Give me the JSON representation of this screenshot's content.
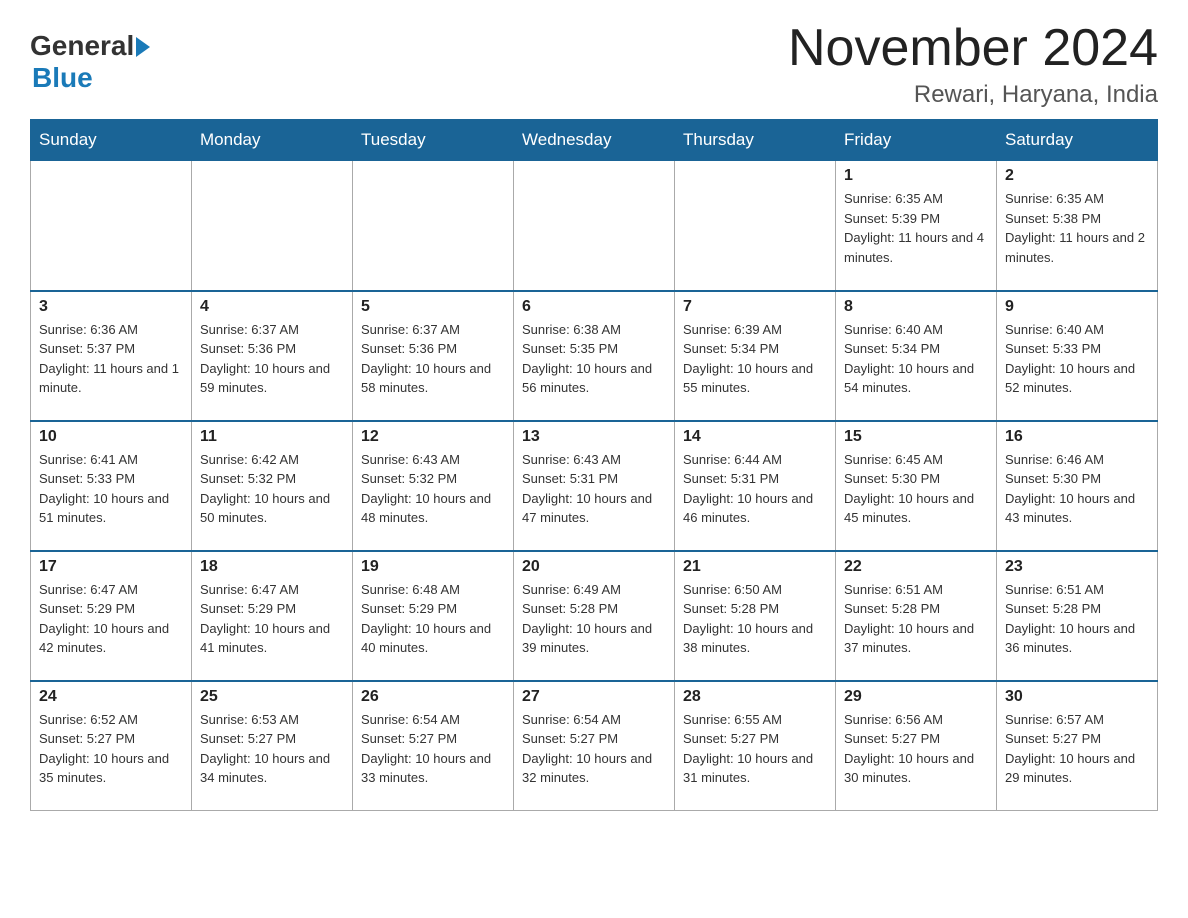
{
  "header": {
    "logo": {
      "general": "General",
      "arrow": "▶",
      "blue": "Blue"
    },
    "month_title": "November 2024",
    "location": "Rewari, Haryana, India"
  },
  "calendar": {
    "weekdays": [
      "Sunday",
      "Monday",
      "Tuesday",
      "Wednesday",
      "Thursday",
      "Friday",
      "Saturday"
    ],
    "weeks": [
      [
        {
          "day": "",
          "info": ""
        },
        {
          "day": "",
          "info": ""
        },
        {
          "day": "",
          "info": ""
        },
        {
          "day": "",
          "info": ""
        },
        {
          "day": "",
          "info": ""
        },
        {
          "day": "1",
          "info": "Sunrise: 6:35 AM\nSunset: 5:39 PM\nDaylight: 11 hours and 4 minutes."
        },
        {
          "day": "2",
          "info": "Sunrise: 6:35 AM\nSunset: 5:38 PM\nDaylight: 11 hours and 2 minutes."
        }
      ],
      [
        {
          "day": "3",
          "info": "Sunrise: 6:36 AM\nSunset: 5:37 PM\nDaylight: 11 hours and 1 minute."
        },
        {
          "day": "4",
          "info": "Sunrise: 6:37 AM\nSunset: 5:36 PM\nDaylight: 10 hours and 59 minutes."
        },
        {
          "day": "5",
          "info": "Sunrise: 6:37 AM\nSunset: 5:36 PM\nDaylight: 10 hours and 58 minutes."
        },
        {
          "day": "6",
          "info": "Sunrise: 6:38 AM\nSunset: 5:35 PM\nDaylight: 10 hours and 56 minutes."
        },
        {
          "day": "7",
          "info": "Sunrise: 6:39 AM\nSunset: 5:34 PM\nDaylight: 10 hours and 55 minutes."
        },
        {
          "day": "8",
          "info": "Sunrise: 6:40 AM\nSunset: 5:34 PM\nDaylight: 10 hours and 54 minutes."
        },
        {
          "day": "9",
          "info": "Sunrise: 6:40 AM\nSunset: 5:33 PM\nDaylight: 10 hours and 52 minutes."
        }
      ],
      [
        {
          "day": "10",
          "info": "Sunrise: 6:41 AM\nSunset: 5:33 PM\nDaylight: 10 hours and 51 minutes."
        },
        {
          "day": "11",
          "info": "Sunrise: 6:42 AM\nSunset: 5:32 PM\nDaylight: 10 hours and 50 minutes."
        },
        {
          "day": "12",
          "info": "Sunrise: 6:43 AM\nSunset: 5:32 PM\nDaylight: 10 hours and 48 minutes."
        },
        {
          "day": "13",
          "info": "Sunrise: 6:43 AM\nSunset: 5:31 PM\nDaylight: 10 hours and 47 minutes."
        },
        {
          "day": "14",
          "info": "Sunrise: 6:44 AM\nSunset: 5:31 PM\nDaylight: 10 hours and 46 minutes."
        },
        {
          "day": "15",
          "info": "Sunrise: 6:45 AM\nSunset: 5:30 PM\nDaylight: 10 hours and 45 minutes."
        },
        {
          "day": "16",
          "info": "Sunrise: 6:46 AM\nSunset: 5:30 PM\nDaylight: 10 hours and 43 minutes."
        }
      ],
      [
        {
          "day": "17",
          "info": "Sunrise: 6:47 AM\nSunset: 5:29 PM\nDaylight: 10 hours and 42 minutes."
        },
        {
          "day": "18",
          "info": "Sunrise: 6:47 AM\nSunset: 5:29 PM\nDaylight: 10 hours and 41 minutes."
        },
        {
          "day": "19",
          "info": "Sunrise: 6:48 AM\nSunset: 5:29 PM\nDaylight: 10 hours and 40 minutes."
        },
        {
          "day": "20",
          "info": "Sunrise: 6:49 AM\nSunset: 5:28 PM\nDaylight: 10 hours and 39 minutes."
        },
        {
          "day": "21",
          "info": "Sunrise: 6:50 AM\nSunset: 5:28 PM\nDaylight: 10 hours and 38 minutes."
        },
        {
          "day": "22",
          "info": "Sunrise: 6:51 AM\nSunset: 5:28 PM\nDaylight: 10 hours and 37 minutes."
        },
        {
          "day": "23",
          "info": "Sunrise: 6:51 AM\nSunset: 5:28 PM\nDaylight: 10 hours and 36 minutes."
        }
      ],
      [
        {
          "day": "24",
          "info": "Sunrise: 6:52 AM\nSunset: 5:27 PM\nDaylight: 10 hours and 35 minutes."
        },
        {
          "day": "25",
          "info": "Sunrise: 6:53 AM\nSunset: 5:27 PM\nDaylight: 10 hours and 34 minutes."
        },
        {
          "day": "26",
          "info": "Sunrise: 6:54 AM\nSunset: 5:27 PM\nDaylight: 10 hours and 33 minutes."
        },
        {
          "day": "27",
          "info": "Sunrise: 6:54 AM\nSunset: 5:27 PM\nDaylight: 10 hours and 32 minutes."
        },
        {
          "day": "28",
          "info": "Sunrise: 6:55 AM\nSunset: 5:27 PM\nDaylight: 10 hours and 31 minutes."
        },
        {
          "day": "29",
          "info": "Sunrise: 6:56 AM\nSunset: 5:27 PM\nDaylight: 10 hours and 30 minutes."
        },
        {
          "day": "30",
          "info": "Sunrise: 6:57 AM\nSunset: 5:27 PM\nDaylight: 10 hours and 29 minutes."
        }
      ]
    ]
  }
}
